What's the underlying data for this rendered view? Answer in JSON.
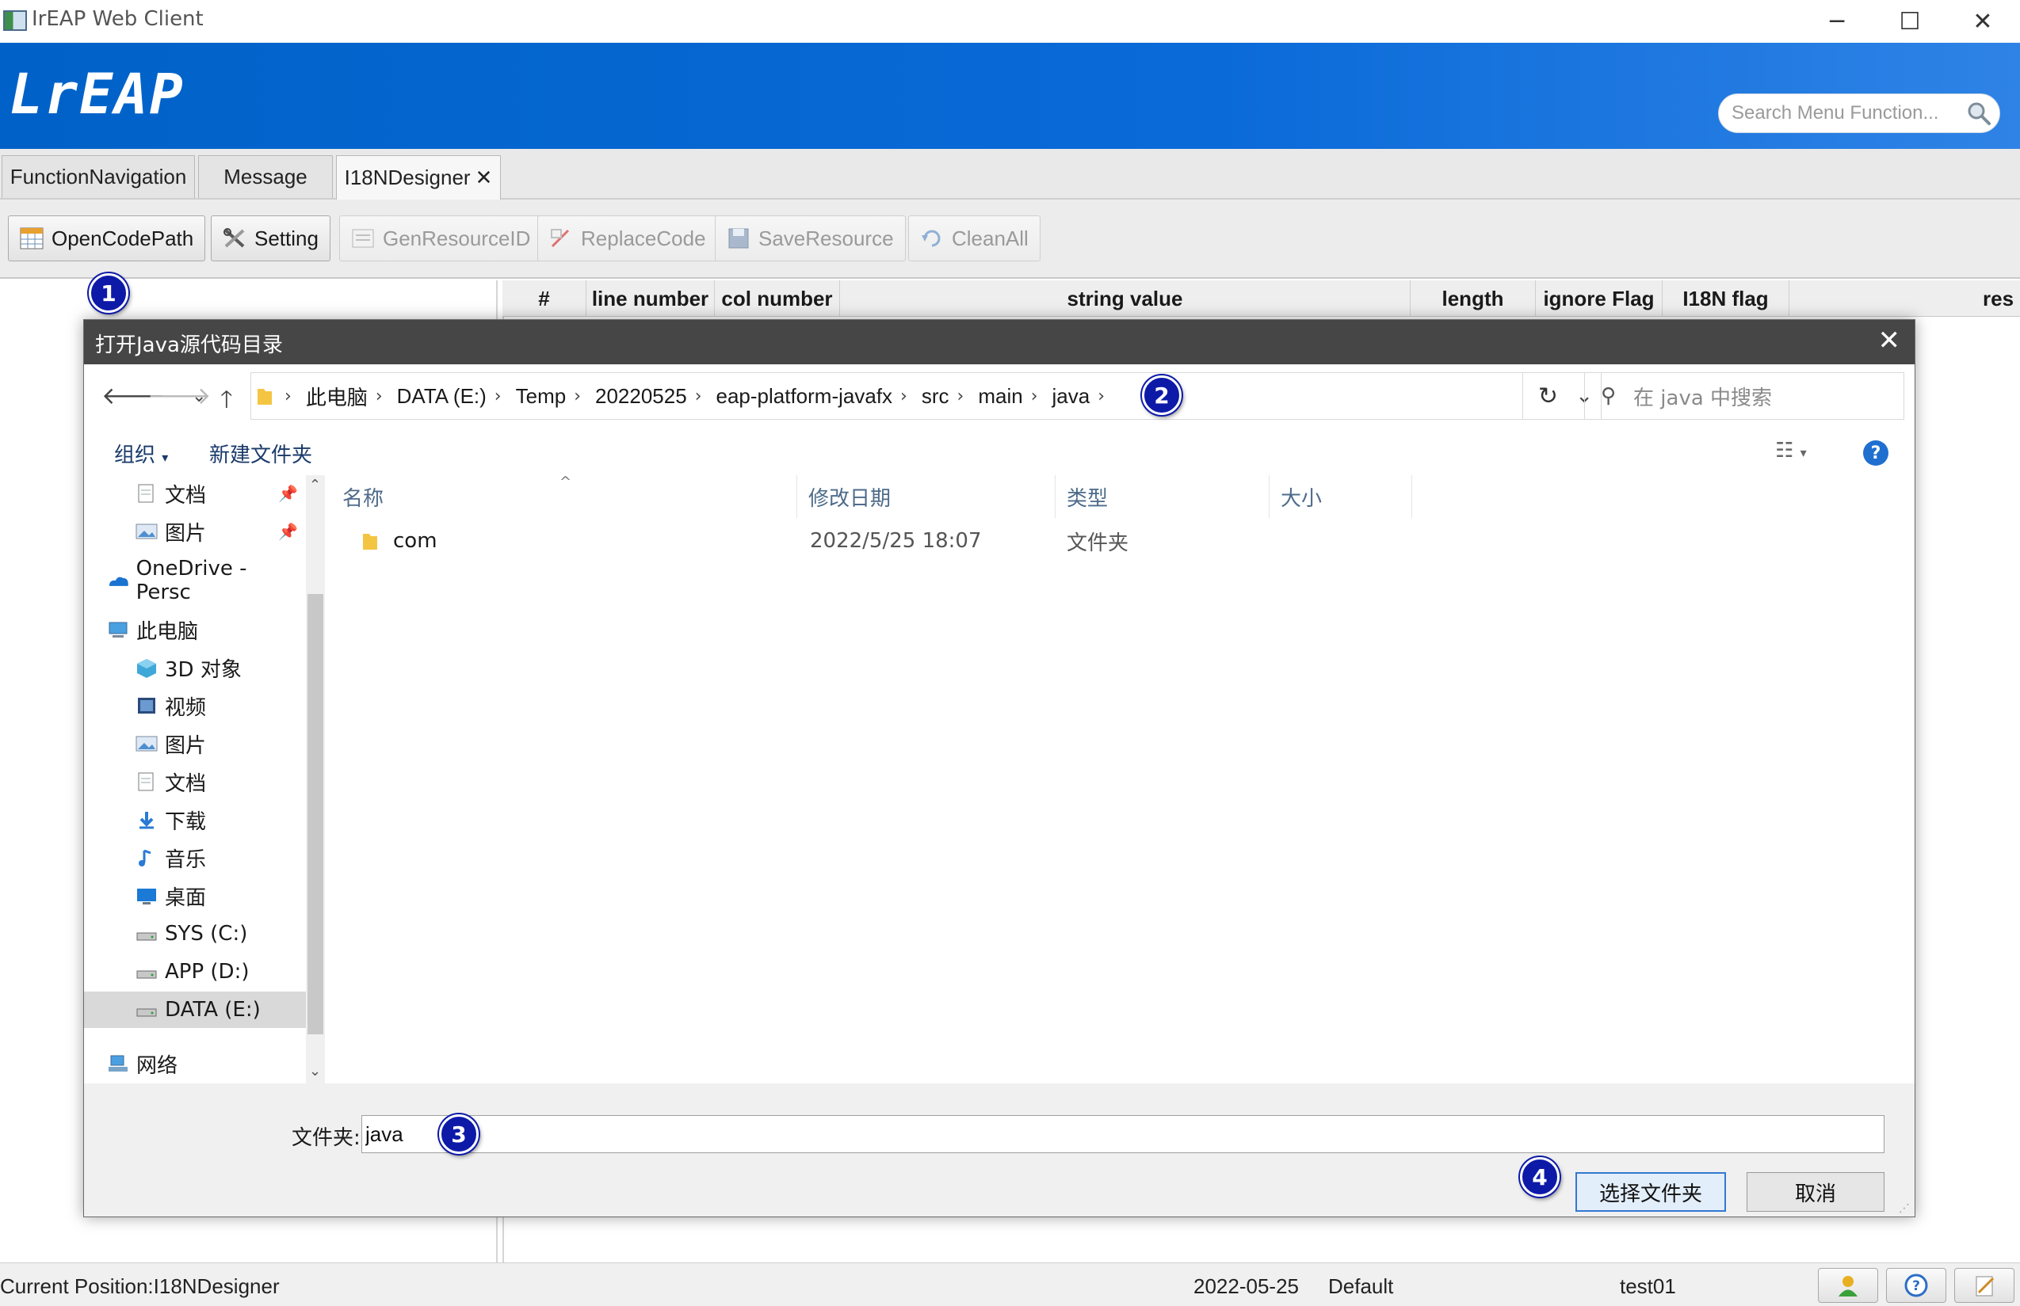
{
  "window": {
    "title": "IrEAP Web Client"
  },
  "brand": {
    "logo": "LrEAP",
    "search_placeholder": "Search Menu Function..."
  },
  "tabs": [
    {
      "label": "FunctionNavigation"
    },
    {
      "label": "Message"
    },
    {
      "label": "I18NDesigner",
      "close": "✕"
    }
  ],
  "toolbar": {
    "open_code_path": "OpenCodePath",
    "setting": "Setting",
    "gen_resource_id": "GenResourceID",
    "replace_code": "ReplaceCode",
    "save_resource": "SaveResource",
    "clean_all": "CleanAll"
  },
  "grid": {
    "columns": [
      "#",
      "line number",
      "col number",
      "string value",
      "length",
      "ignore Flag",
      "I18N flag",
      "res"
    ]
  },
  "dialog": {
    "title": "打开Java源代码目录",
    "breadcrumb": [
      "此电脑",
      "DATA (E:)",
      "Temp",
      "20220525",
      "eap-platform-javafx",
      "src",
      "main",
      "java"
    ],
    "search_placeholder": "在 java 中搜索",
    "organize": "组织",
    "new_folder": "新建文件夹",
    "nav_items": [
      {
        "label": "文档",
        "icon": "document-icon",
        "pinned": true
      },
      {
        "label": "图片",
        "icon": "pictures-icon",
        "pinned": true
      },
      {
        "label": "OneDrive - Persc",
        "icon": "onedrive-icon"
      },
      {
        "label": "此电脑",
        "icon": "computer-icon"
      },
      {
        "label": "3D 对象",
        "icon": "3d-objects-icon"
      },
      {
        "label": "视频",
        "icon": "videos-icon"
      },
      {
        "label": "图片",
        "icon": "pictures-icon"
      },
      {
        "label": "文档",
        "icon": "document-icon"
      },
      {
        "label": "下载",
        "icon": "download-icon"
      },
      {
        "label": "音乐",
        "icon": "music-icon"
      },
      {
        "label": "桌面",
        "icon": "desktop-icon"
      },
      {
        "label": "SYS (C:)",
        "icon": "drive-icon"
      },
      {
        "label": "APP (D:)",
        "icon": "drive-icon"
      },
      {
        "label": "DATA (E:)",
        "icon": "drive-icon",
        "selected": true
      },
      {
        "label": "网络",
        "icon": "network-icon"
      }
    ],
    "columns": {
      "name": "名称",
      "modified": "修改日期",
      "type": "类型",
      "size": "大小"
    },
    "files": [
      {
        "name": "com",
        "modified": "2022/5/25 18:07",
        "type": "文件夹",
        "size": ""
      }
    ],
    "folder_label": "文件夹:",
    "folder_value": "java",
    "select_button": "选择文件夹",
    "cancel_button": "取消"
  },
  "status": {
    "position": "Current Position:I18NDesigner",
    "date": "2022-05-25",
    "profile": "Default",
    "user": "test01"
  },
  "markers": [
    "1",
    "2",
    "3",
    "4"
  ],
  "colors": {
    "brand_blue": "#0062c8",
    "dialog_title": "#464646",
    "marker": "#0d1aa8"
  }
}
